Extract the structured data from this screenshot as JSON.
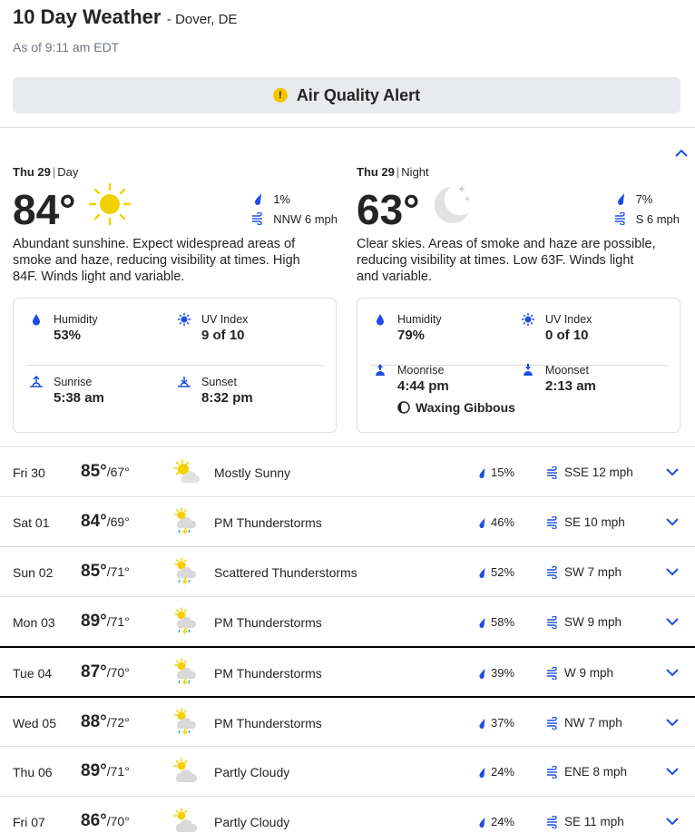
{
  "header": {
    "title": "10 Day Weather",
    "location": "- Dover, DE",
    "as_of": "As of 9:11 am EDT"
  },
  "alert": {
    "label": "Air Quality Alert",
    "icon": "exclamation-icon"
  },
  "today": {
    "day": {
      "date": "Thu 29",
      "period": "Day",
      "temp": "84°",
      "precip": "1%",
      "wind": "NNW 6 mph",
      "narrative": "Abundant sunshine. Expect widespread areas of smoke and haze, reducing visibility at times. High 84F. Winds light and variable.",
      "humidity_label": "Humidity",
      "humidity": "53%",
      "uv_label": "UV Index",
      "uv": "9 of 10",
      "rise_label": "Sunrise",
      "rise": "5:38 am",
      "set_label": "Sunset",
      "set": "8:32 pm"
    },
    "night": {
      "date": "Thu 29",
      "period": "Night",
      "temp": "63°",
      "precip": "7%",
      "wind": "S 6 mph",
      "narrative": "Clear skies. Areas of smoke and haze are possible, reducing visibility at times. Low 63F. Winds light and variable.",
      "humidity_label": "Humidity",
      "humidity": "79%",
      "uv_label": "UV Index",
      "uv": "0 of 10",
      "rise_label": "Moonrise",
      "rise": "4:44 pm",
      "set_label": "Moonset",
      "set": "2:13 am",
      "phase": "Waxing Gibbous"
    }
  },
  "forecast": [
    {
      "day": "Fri 30",
      "high": "85°",
      "low": "/67°",
      "icon": "mostly-sunny-icon",
      "cond": "Mostly Sunny",
      "precip": "15%",
      "wind": "SSE 12 mph"
    },
    {
      "day": "Sat 01",
      "high": "84°",
      "low": "/69°",
      "icon": "thunderstorm-icon",
      "cond": "PM Thunderstorms",
      "precip": "46%",
      "wind": "SE 10 mph"
    },
    {
      "day": "Sun 02",
      "high": "85°",
      "low": "/71°",
      "icon": "thunderstorm-icon",
      "cond": "Scattered Thunderstorms",
      "precip": "52%",
      "wind": "SW 7 mph"
    },
    {
      "day": "Mon 03",
      "high": "89°",
      "low": "/71°",
      "icon": "thunderstorm-icon",
      "cond": "PM Thunderstorms",
      "precip": "58%",
      "wind": "SW 9 mph"
    },
    {
      "day": "Tue 04",
      "high": "87°",
      "low": "/70°",
      "icon": "thunderstorm-icon",
      "cond": "PM Thunderstorms",
      "precip": "39%",
      "wind": "W 9 mph"
    },
    {
      "day": "Wed 05",
      "high": "88°",
      "low": "/72°",
      "icon": "thunderstorm-icon",
      "cond": "PM Thunderstorms",
      "precip": "37%",
      "wind": "NW 7 mph"
    },
    {
      "day": "Thu 06",
      "high": "89°",
      "low": "/71°",
      "icon": "partly-cloudy-icon",
      "cond": "Partly Cloudy",
      "precip": "24%",
      "wind": "ENE 8 mph"
    },
    {
      "day": "Fri 07",
      "high": "86°",
      "low": "/70°",
      "icon": "partly-cloudy-icon",
      "cond": "Partly Cloudy",
      "precip": "24%",
      "wind": "SE 11 mph"
    }
  ],
  "colors": {
    "accent": "#1b4de4",
    "sun": "#f5d000",
    "text": "#252422",
    "muted": "#6f7585"
  }
}
